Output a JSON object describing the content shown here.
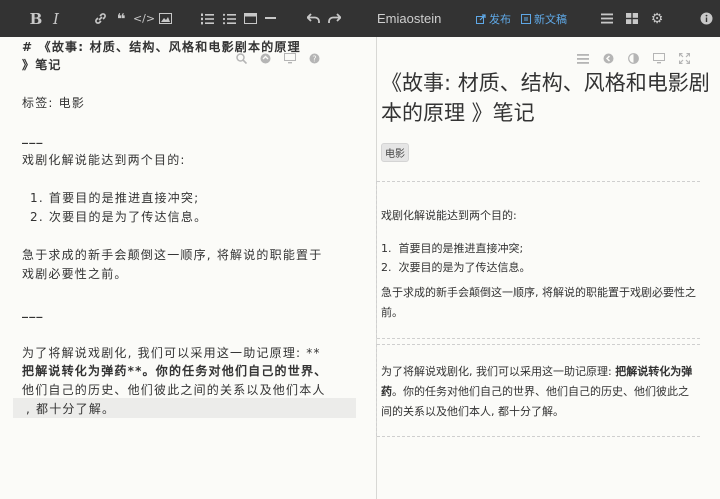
{
  "toolbar": {
    "title": "Emiaostein",
    "publish_label": "发布",
    "new_doc_label": "新文稿",
    "format_buttons": [
      {
        "name": "bold-button",
        "glyph": "B"
      },
      {
        "name": "italic-button",
        "glyph": "I"
      }
    ]
  },
  "editor": {
    "lines": [
      "# 《故事: 材质、结构、风格和电影剧本的原理",
      "》笔记",
      "标签:  电影",
      "___",
      "戏剧化解说能达到两个目的:",
      "1. 首要目的是推进直接冲突;",
      "2. 次要目的是为了传达信息。",
      "急于求成的新手会颠倒这一顺序, 将解说的职能置于",
      "戏剧必要性之前。",
      "___",
      "为了将解说戏剧化, 我们可以采用这一助记原理: **",
      "把解说转化为弹药**。你的任务对他们自己的世界、",
      "他们自己的历史、他们彼此之间的关系以及他们本人",
      ", 都十分了解。"
    ]
  },
  "preview": {
    "title": "《故事: 材质、结构、风格和电影剧本的原理 》笔记",
    "tag": "电影",
    "intro": "戏剧化解说能达到两个目的:",
    "list": [
      "首要目的是推进直接冲突;",
      "次要目的是为了传达信息。"
    ],
    "list_markers": [
      "1.",
      "2."
    ],
    "para1": "急于求成的新手会颠倒这一顺序, 将解说的职能置于戏剧必要性之前。",
    "para2_prefix": "为了将解说戏剧化, 我们可以采用这一助记原理: ",
    "para2_bold": "把解说转化为弹药",
    "para2_suffix": "。你的任务对他们自己的世界、他们自己的历史、他们彼此之间的关系以及他们本人, 都十分了解。"
  }
}
